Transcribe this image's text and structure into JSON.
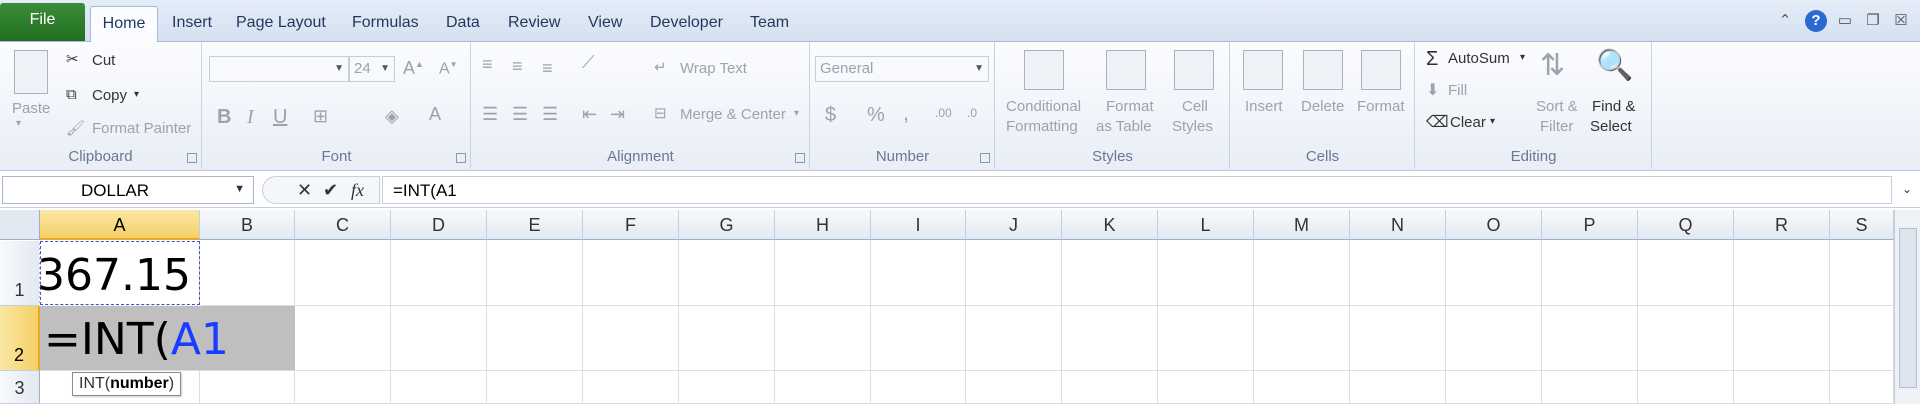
{
  "tabs": [
    {
      "label": "File",
      "kind": "file"
    },
    {
      "label": "Home",
      "kind": "active"
    },
    {
      "label": "Insert"
    },
    {
      "label": "Page Layout"
    },
    {
      "label": "Formulas"
    },
    {
      "label": "Data"
    },
    {
      "label": "Review"
    },
    {
      "label": "View"
    },
    {
      "label": "Developer"
    },
    {
      "label": "Team"
    }
  ],
  "ribbon": {
    "clipboard": {
      "label": "Clipboard",
      "paste": "Paste",
      "cut": "Cut",
      "copy": "Copy",
      "format_painter": "Format Painter"
    },
    "font": {
      "label": "Font",
      "size": "24",
      "bold": "B",
      "italic": "I",
      "underline": "U"
    },
    "alignment": {
      "label": "Alignment",
      "wrap_text": "Wrap Text",
      "merge_center": "Merge & Center"
    },
    "number": {
      "label": "Number",
      "format": "General",
      "currency": "$",
      "percent": "%",
      "comma": ","
    },
    "styles": {
      "label": "Styles",
      "conditional_1": "Conditional",
      "conditional_2": "Formatting",
      "format_table_1": "Format",
      "format_table_2": "as Table",
      "cell_styles_1": "Cell",
      "cell_styles_2": "Styles"
    },
    "cells": {
      "label": "Cells",
      "insert": "Insert",
      "delete": "Delete",
      "format": "Format"
    },
    "editing": {
      "label": "Editing",
      "autosum": "AutoSum",
      "fill": "Fill",
      "clear": "Clear",
      "sort_1": "Sort &",
      "sort_2": "Filter",
      "find_1": "Find &",
      "find_2": "Select"
    }
  },
  "formula_bar": {
    "name_box": "DOLLAR",
    "formula": "=INT(A1",
    "fx": "fx"
  },
  "columns": [
    "A",
    "B",
    "C",
    "D",
    "E",
    "F",
    "G",
    "H",
    "I",
    "J",
    "K",
    "L",
    "M",
    "N",
    "O",
    "P",
    "Q",
    "R",
    "S"
  ],
  "rows": [
    "1",
    "2",
    "3"
  ],
  "cells": {
    "A1": "367.15",
    "A2_prefix": "=INT(",
    "A2_ref": "A1"
  },
  "tooltip": {
    "fn": "INT(",
    "arg": "number",
    "close": ")"
  },
  "colors": {
    "file_tab": "#2a7d2a",
    "selected_header": "#f5cf66",
    "ref_blue": "#1a3cff",
    "row2_fill": "#bfbfbf"
  }
}
